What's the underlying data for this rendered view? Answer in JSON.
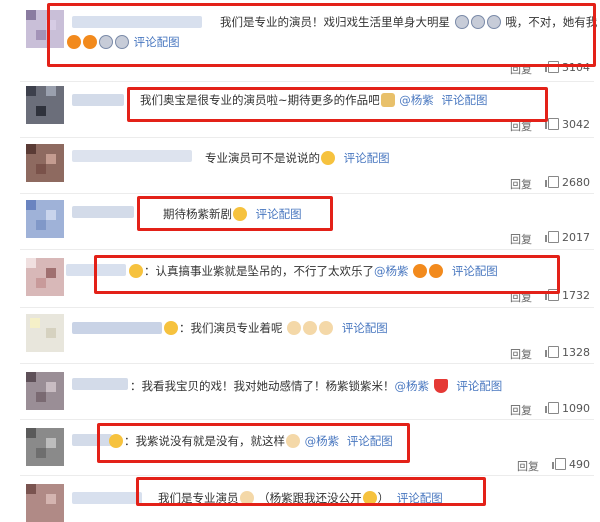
{
  "comments": [
    {
      "text": "我们是专业的演员！戏归戏生活里单身大明星",
      "text2": "哦，不对，她有我",
      "link": "评论配图",
      "reply": "回复",
      "likes": "3104"
    },
    {
      "text": "我们奥宝是很专业的演员啦~期待更多的作品吧",
      "mention": "@杨紫",
      "link": "评论配图",
      "reply": "回复",
      "likes": "3042"
    },
    {
      "text": "专业演员可不是说说的",
      "link": "评论配图",
      "reply": "回复",
      "likes": "2680"
    },
    {
      "text": "期待杨紫新剧",
      "link": "评论配图",
      "reply": "回复",
      "likes": "2017"
    },
    {
      "text": "认真搞事业紫就是坠吊的，不行了太欢乐了",
      "mention": "@杨紫",
      "link": "评论配图",
      "reply": "回复",
      "likes": "1732"
    },
    {
      "text": "我们演员专业着呢",
      "link": "评论配图",
      "reply": "回复",
      "likes": "1328"
    },
    {
      "text": "我看我宝贝的戏！我对她动感情了！杨紫锁紫米！",
      "mention": "@杨紫",
      "link": "评论配图",
      "reply": "回复",
      "likes": "1090"
    },
    {
      "text": "我紫说没有就是没有，就这样",
      "mention": "@杨紫",
      "link": "评论配图",
      "reply": "回复",
      "likes": "490"
    },
    {
      "text": "我们是专业演员",
      "text2": "（杨紫跟我还没公开",
      "link": "评论配图"
    }
  ],
  "colors": {
    "highlight_box": "#e32118",
    "link": "#4a78c0"
  }
}
